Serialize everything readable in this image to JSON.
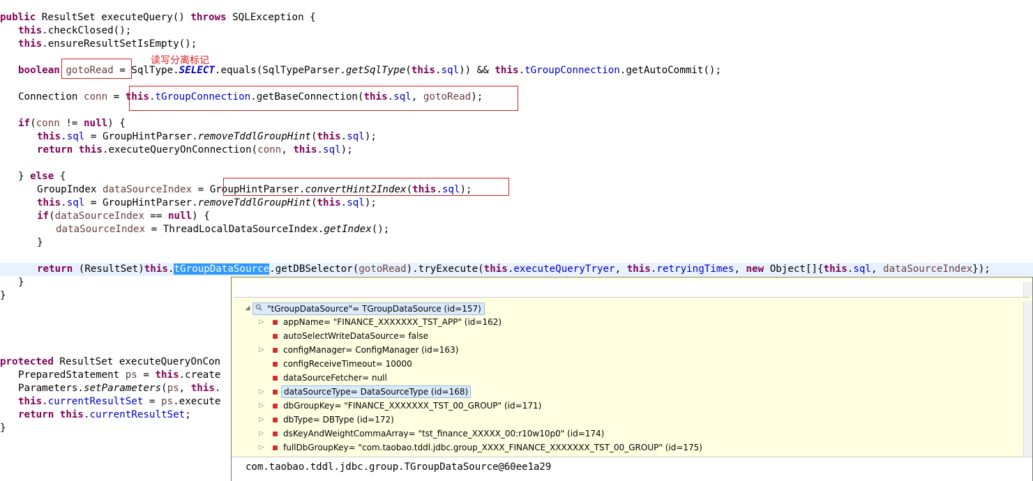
{
  "code": {
    "method1": {
      "signature": "public ResultSet executeQuery() throws SQLException {",
      "check_closed": "this.checkClosed();",
      "ensure_not_empty": "this.ensureResultSetIsEmpty();",
      "goto_read_line": "boolean gotoRead = SqlType.SELECT.equals(SqlTypeParser.getSqlType(this.sql)) && this.tGroupConnection.getAutoCommit();",
      "connection_line": "Connection conn = this.tGroupConnection.getBaseConnection(this.sql, gotoRead);",
      "if_conn": "if(conn != null) {",
      "remove_hint_1": "this.sql = GroupHintParser.removeTddlGroupHint(this.sql);",
      "return_on_conn": "return this.executeQueryOnConnection(conn, this.sql);",
      "else": "} else {",
      "ds_index_line": "GroupIndex dataSourceIndex = GroupHintParser.convertHint2Index(this.sql);",
      "remove_hint_2": "this.sql = GroupHintParser.removeTddlGroupHint(this.sql);",
      "if_ds_null": "if(dataSourceIndex == null) {",
      "thread_local": "dataSourceIndex = ThreadLocalDataSourceIndex.getIndex();",
      "close_inner": "}",
      "return_try": "return (ResultSet)this.tGroupDataSource.getDBSelector(gotoRead).tryExecute(this.executeQueryTryer, this.retryingTimes, new Object[]{this.sql, dataSourceIndex});",
      "close_else": "}",
      "close_method": "}"
    },
    "method2": {
      "signature": "protected ResultSet executeQueryOnCon",
      "prepared": "PreparedStatement ps = this.create",
      "parameters": "Parameters.setParameters(ps, this.",
      "current_rs": "this.currentResultSet = ps.execute",
      "return_rs": "return this.currentResultSet;",
      "close_method": "}"
    }
  },
  "annotation": "读写分离标记",
  "selected_token": "tGroupDataSource",
  "debug_popup": {
    "root": "\"tGroupDataSource\"= TGroupDataSource  (id=157)",
    "fields": [
      {
        "text": "appName= \"FINANCE_XXXXXXX_TST_APP\" (id=162)",
        "expandable": true,
        "highlight": false
      },
      {
        "text": "autoSelectWriteDataSource= false",
        "expandable": false,
        "highlight": false
      },
      {
        "text": "configManager= ConfigManager  (id=163)",
        "expandable": true,
        "highlight": false
      },
      {
        "text": "configReceiveTimeout= 10000",
        "expandable": false,
        "highlight": false
      },
      {
        "text": "dataSourceFetcher= null",
        "expandable": false,
        "highlight": false
      },
      {
        "text": "dataSourceType= DataSourceType  (id=168)",
        "expandable": true,
        "highlight": true
      },
      {
        "text": "dbGroupKey= \"FINANCE_XXXXXXX_TST_00_GROUP\" (id=171)",
        "expandable": true,
        "highlight": false
      },
      {
        "text": "dbType= DBType  (id=172)",
        "expandable": true,
        "highlight": false
      },
      {
        "text": "dsKeyAndWeightCommaArray= \"tst_finance_XXXXX_00:r10w10p0\" (id=174)",
        "expandable": true,
        "highlight": false
      },
      {
        "text": "fullDbGroupKey= \"com.taobao.tddl.jdbc.group_XXXX_FINANCE_XXXXXXX_TST_00_GROUP\" (id=175)",
        "expandable": true,
        "highlight": false
      }
    ],
    "detail": "com.taobao.tddl.jdbc.group.TGroupDataSource@60ee1a29"
  },
  "colors": {
    "keyword": "#7f0055",
    "field": "#0000c0",
    "local_var": "#6a3e3e",
    "annotation_red": "#e01b1b",
    "popup_bg": "#ffffe1",
    "selection": "#3399ff",
    "current_line": "#e8f2fe"
  },
  "icons": [
    "magnifier-icon",
    "field-icon",
    "expand-arrow-icon",
    "collapse-arrow-icon"
  ]
}
